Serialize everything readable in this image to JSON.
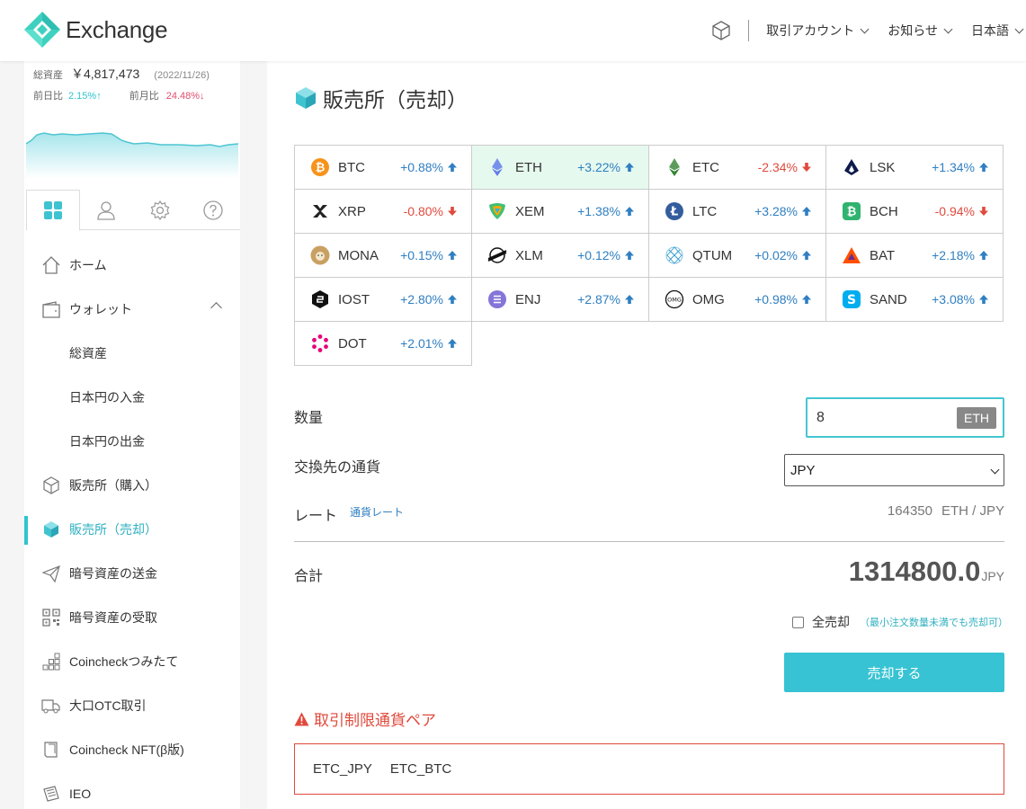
{
  "app": {
    "logo_text": "Exchange",
    "accent": "#37c3d3"
  },
  "header": {
    "nav": [
      {
        "label": "取引アカウント"
      },
      {
        "label": "お知らせ"
      },
      {
        "label": "日本語"
      }
    ]
  },
  "sidebar": {
    "assets_label": "総資産",
    "assets_value": "￥4,817,473",
    "assets_date": "(2022/11/26)",
    "day_label": "前日比",
    "day_change": "2.15%↑",
    "month_label": "前月比",
    "month_change": "24.48%↓",
    "tabs": [
      "dashboard-icon",
      "user-icon",
      "gear-icon",
      "help-icon"
    ],
    "menu": [
      {
        "label": "ホーム",
        "icon": "home-icon"
      },
      {
        "label": "ウォレット",
        "icon": "wallet-icon"
      },
      {
        "label": "総資産"
      },
      {
        "label": "日本円の入金"
      },
      {
        "label": "日本円の出金"
      },
      {
        "label": "販売所（購入）",
        "icon": "cube-icon"
      },
      {
        "label": "販売所（売却）",
        "icon": "cube-icon"
      },
      {
        "label": "暗号資産の送金",
        "icon": "send-icon"
      },
      {
        "label": "暗号資産の受取",
        "icon": "qr-icon"
      },
      {
        "label": "Coincheckつみたて",
        "icon": "stack-icon"
      },
      {
        "label": "大口OTC取引",
        "icon": "truck-icon"
      },
      {
        "label": "Coincheck NFT(β版)",
        "icon": "nft-icon"
      },
      {
        "label": "IEO",
        "icon": "ieo-icon"
      }
    ]
  },
  "main": {
    "title": "販売所（売却）",
    "coins": [
      {
        "symbol": "BTC",
        "change": "+0.88%",
        "dir": "up",
        "color": "#f7931a"
      },
      {
        "symbol": "ETH",
        "change": "+3.22%",
        "dir": "up",
        "color": "#627eea"
      },
      {
        "symbol": "ETC",
        "change": "-2.34%",
        "dir": "down",
        "color": "#328332"
      },
      {
        "symbol": "LSK",
        "change": "+1.34%",
        "dir": "up",
        "color": "#0d1b4b"
      },
      {
        "symbol": "XRP",
        "change": "-0.80%",
        "dir": "down",
        "color": "#222222"
      },
      {
        "symbol": "XEM",
        "change": "+1.38%",
        "dir": "up",
        "color": "#41bf76"
      },
      {
        "symbol": "LTC",
        "change": "+3.28%",
        "dir": "up",
        "color": "#345d9d"
      },
      {
        "symbol": "BCH",
        "change": "-0.94%",
        "dir": "down",
        "color": "#2fb36f"
      },
      {
        "symbol": "MONA",
        "change": "+0.15%",
        "dir": "up",
        "color": "#c9a063"
      },
      {
        "symbol": "XLM",
        "change": "+0.12%",
        "dir": "up",
        "color": "#111111"
      },
      {
        "symbol": "QTUM",
        "change": "+0.02%",
        "dir": "up",
        "color": "#2e9ad0"
      },
      {
        "symbol": "BAT",
        "change": "+2.18%",
        "dir": "up",
        "color": "#ff5000"
      },
      {
        "symbol": "IOST",
        "change": "+2.80%",
        "dir": "up",
        "color": "#111111"
      },
      {
        "symbol": "ENJ",
        "change": "+2.87%",
        "dir": "up",
        "color": "#7866d5"
      },
      {
        "symbol": "OMG",
        "change": "+0.98%",
        "dir": "up",
        "color": "#111111"
      },
      {
        "symbol": "SAND",
        "change": "+3.08%",
        "dir": "up",
        "color": "#00adef"
      },
      {
        "symbol": "DOT",
        "change": "+2.01%",
        "dir": "up",
        "color": "#e6007a"
      }
    ],
    "qty_label": "数量",
    "qty_value": "8",
    "qty_unit": "ETH",
    "target_label": "交換先の通貨",
    "target_value": "JPY",
    "rate_label": "レート",
    "rate_link": "通貨レート",
    "rate_value": "164350",
    "rate_pair": "ETH / JPY",
    "total_label": "合計",
    "total_value": "1314800.0",
    "total_currency": "JPY",
    "sellall_label": "全売却",
    "sellall_note": "（最小注文数量未満でも売却可）",
    "sell_button": "売却する",
    "warn_title": "取引制限通貨ペア",
    "restricted_pairs": [
      "ETC_JPY",
      "ETC_BTC"
    ]
  }
}
